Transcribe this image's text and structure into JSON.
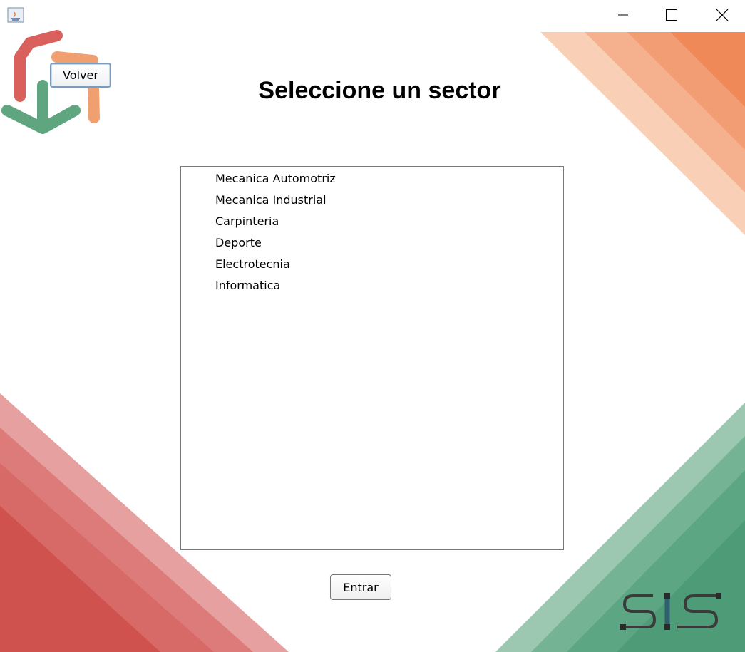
{
  "window": {
    "minimize_icon": "minimize-icon",
    "maximize_icon": "maximize-icon",
    "close_icon": "close-icon",
    "app_icon": "java-icon"
  },
  "header": {
    "back_label": "Volver",
    "title": "Seleccione un sector"
  },
  "sectors": [
    "Mecanica Automotriz",
    "Mecanica Industrial",
    "Carpinteria",
    "Deporte",
    "Electrotecnia",
    "Informatica"
  ],
  "footer": {
    "enter_label": "Entrar"
  },
  "colors": {
    "orange": "#f08a5d",
    "red": "#d9534f",
    "green": "#4e9f78",
    "dark": "#3a3a3a",
    "teal": "#2f5f6f"
  }
}
